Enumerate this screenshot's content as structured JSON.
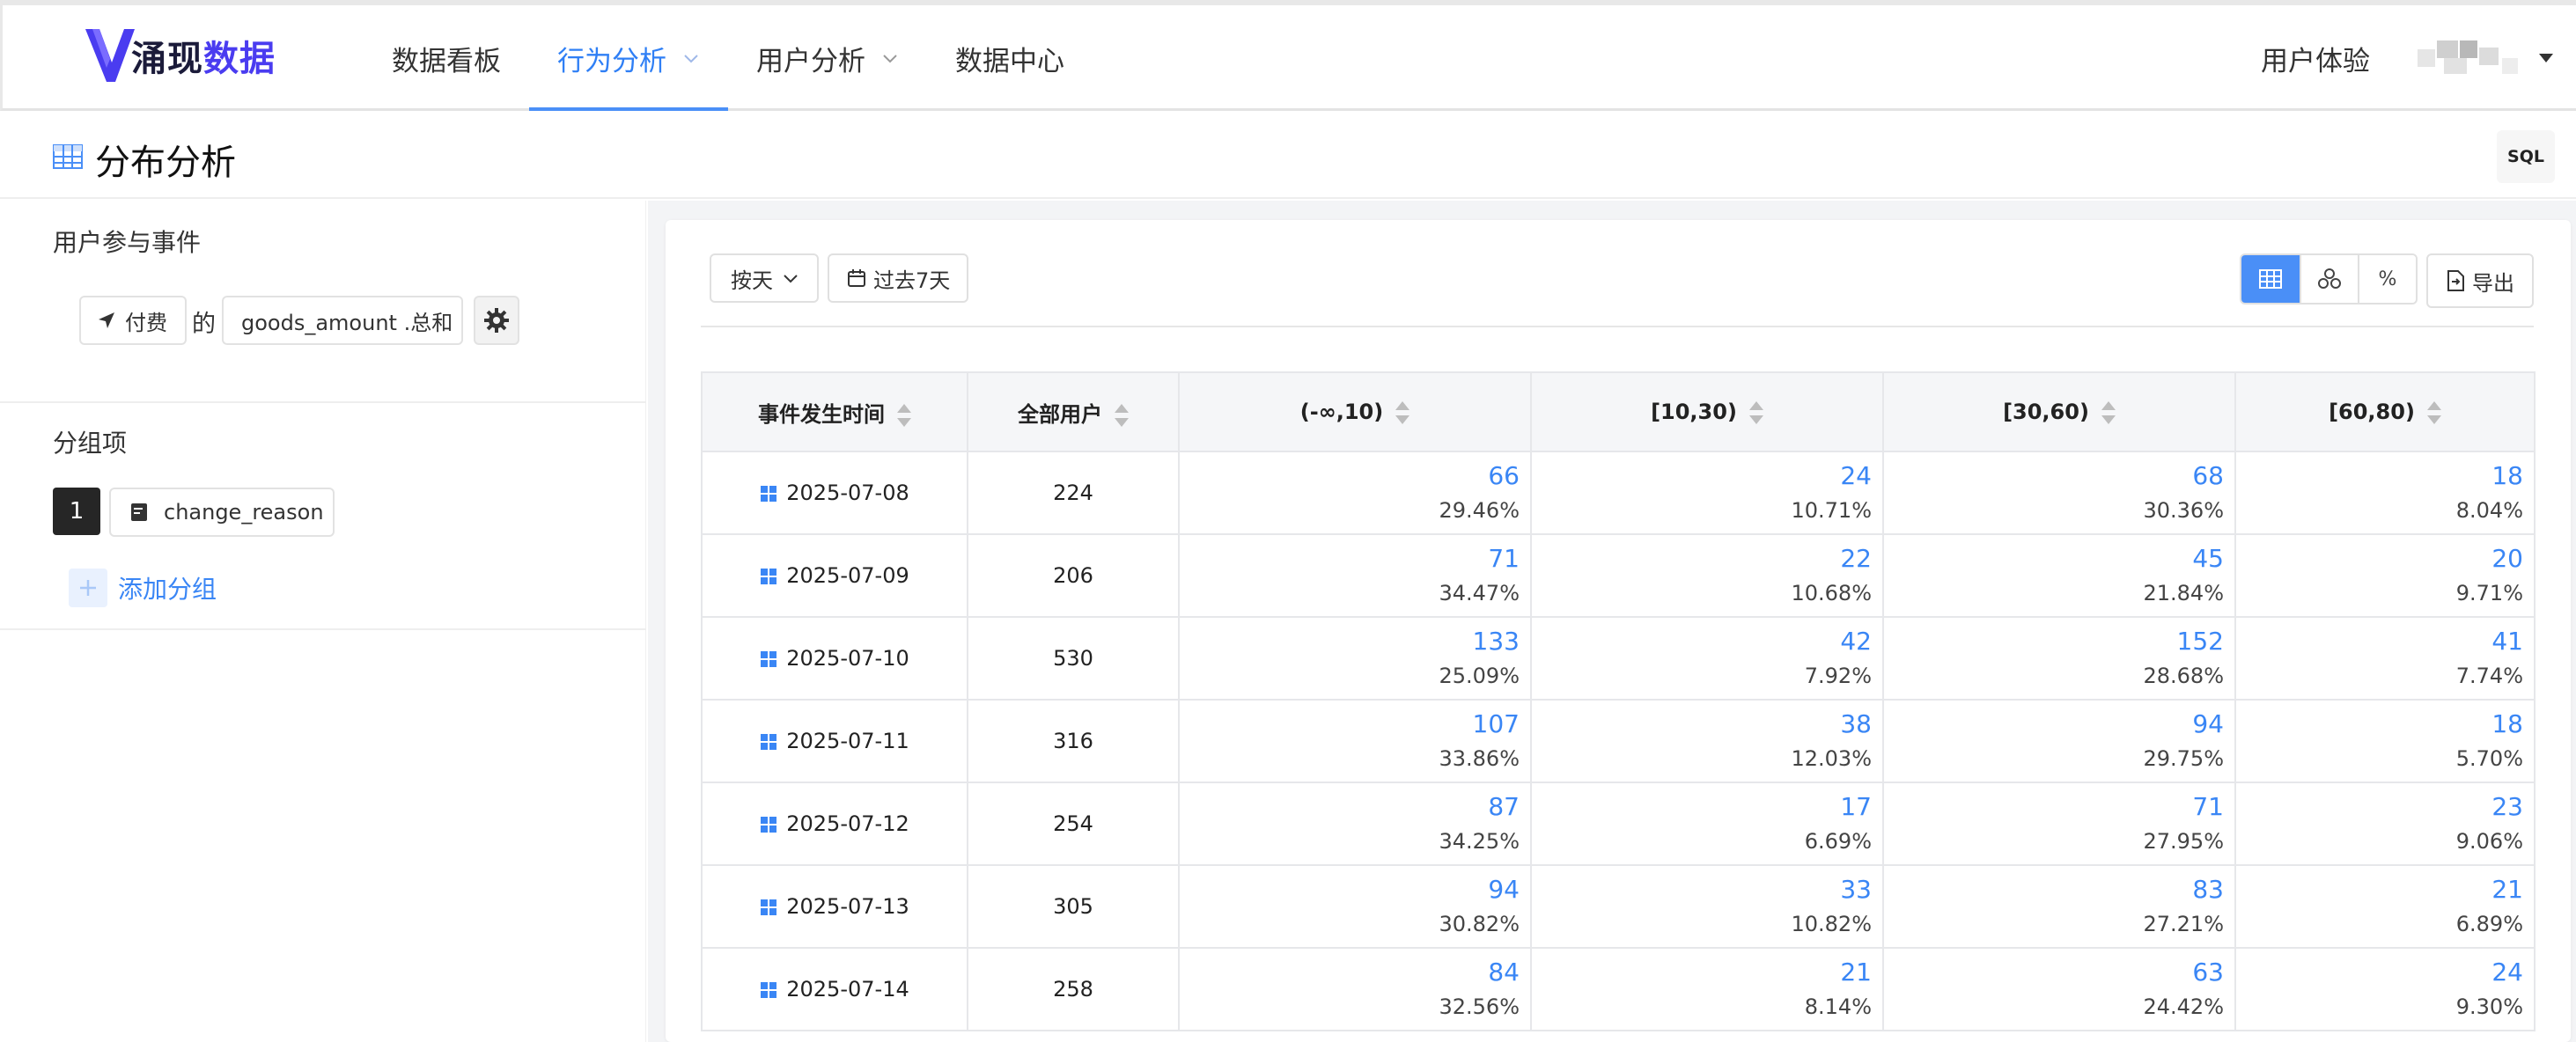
{
  "brand": {
    "logo_text_dark": "涌现",
    "logo_text_accent": "数据"
  },
  "nav": {
    "items": [
      {
        "label": "数据看板"
      },
      {
        "label": "行为分析"
      },
      {
        "label": "用户分析"
      },
      {
        "label": "数据中心"
      }
    ],
    "active_index": 1,
    "user_experience": "用户体验"
  },
  "page": {
    "title": "分布分析",
    "sql_label": "SQL"
  },
  "sidebar": {
    "event_section": "用户参与事件",
    "event_name": "付费",
    "of_text": "的",
    "property": "goods_amount .总和",
    "group_section": "分组项",
    "group_index": "1",
    "group_field": "change_reason",
    "add_group": "添加分组"
  },
  "toolbar": {
    "granularity": "按天",
    "date_range": "过去7天",
    "export": "导出",
    "percent_symbol": "%"
  },
  "table": {
    "headers": [
      "事件发生时间",
      "全部用户",
      "(-∞,10)",
      "[10,30)",
      "[30,60)",
      "[60,80)"
    ],
    "rows": [
      {
        "date": "2025-07-08",
        "total": "224",
        "cells": [
          {
            "count": "66",
            "pct": "29.46%"
          },
          {
            "count": "24",
            "pct": "10.71%"
          },
          {
            "count": "68",
            "pct": "30.36%"
          },
          {
            "count": "18",
            "pct": "8.04%"
          }
        ]
      },
      {
        "date": "2025-07-09",
        "total": "206",
        "cells": [
          {
            "count": "71",
            "pct": "34.47%"
          },
          {
            "count": "22",
            "pct": "10.68%"
          },
          {
            "count": "45",
            "pct": "21.84%"
          },
          {
            "count": "20",
            "pct": "9.71%"
          }
        ]
      },
      {
        "date": "2025-07-10",
        "total": "530",
        "cells": [
          {
            "count": "133",
            "pct": "25.09%"
          },
          {
            "count": "42",
            "pct": "7.92%"
          },
          {
            "count": "152",
            "pct": "28.68%"
          },
          {
            "count": "41",
            "pct": "7.74%"
          }
        ]
      },
      {
        "date": "2025-07-11",
        "total": "316",
        "cells": [
          {
            "count": "107",
            "pct": "33.86%"
          },
          {
            "count": "38",
            "pct": "12.03%"
          },
          {
            "count": "94",
            "pct": "29.75%"
          },
          {
            "count": "18",
            "pct": "5.70%"
          }
        ]
      },
      {
        "date": "2025-07-12",
        "total": "254",
        "cells": [
          {
            "count": "87",
            "pct": "34.25%"
          },
          {
            "count": "17",
            "pct": "6.69%"
          },
          {
            "count": "71",
            "pct": "27.95%"
          },
          {
            "count": "23",
            "pct": "9.06%"
          }
        ]
      },
      {
        "date": "2025-07-13",
        "total": "305",
        "cells": [
          {
            "count": "94",
            "pct": "30.82%"
          },
          {
            "count": "33",
            "pct": "10.82%"
          },
          {
            "count": "83",
            "pct": "27.21%"
          },
          {
            "count": "21",
            "pct": "6.89%"
          }
        ]
      },
      {
        "date": "2025-07-14",
        "total": "258",
        "cells": [
          {
            "count": "84",
            "pct": "32.56%"
          },
          {
            "count": "21",
            "pct": "8.14%"
          },
          {
            "count": "63",
            "pct": "24.42%"
          },
          {
            "count": "24",
            "pct": "9.30%"
          }
        ]
      }
    ]
  },
  "colors": {
    "accent": "#3a86f5",
    "nav_active": "#2f7ff5",
    "header_bg": "#f5f6f8",
    "segment_active": "#4a8ff7"
  }
}
